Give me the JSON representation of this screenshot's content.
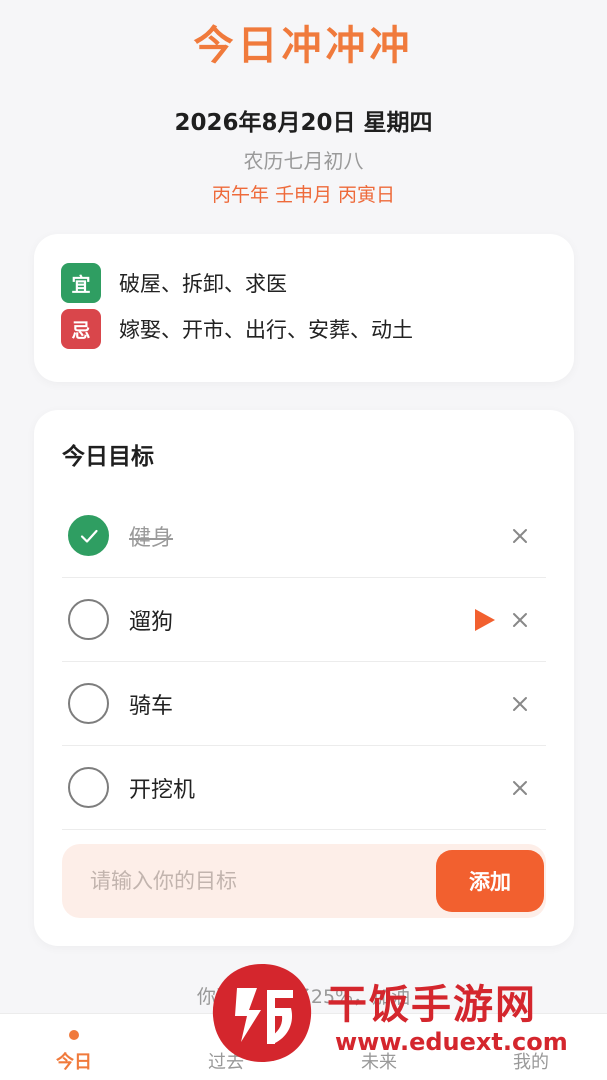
{
  "header": {
    "app_title": "今日冲冲冲",
    "date": "2026年8月20日 星期四",
    "lunar_date": "农历七月初八",
    "ganzhi": "丙午年 壬申月 丙寅日"
  },
  "almanac": {
    "yi_label": "宜",
    "yi_text": "破屋、拆卸、求医",
    "ji_label": "忌",
    "ji_text": "嫁娶、开市、出行、安葬、动土"
  },
  "goals": {
    "title": "今日目标",
    "items": [
      {
        "label": "健身",
        "done": true
      },
      {
        "label": "遛狗",
        "done": false,
        "playing": true
      },
      {
        "label": "骑车",
        "done": false
      },
      {
        "label": "开挖机",
        "done": false
      }
    ],
    "input_placeholder": "请输入你的目标",
    "add_label": "添加"
  },
  "progress": {
    "text": "你已经完成了25%，加油"
  },
  "tabbar": {
    "tabs": [
      "今日",
      "过去",
      "未来",
      "我的"
    ],
    "active_index": 0
  },
  "watermark": {
    "brand": "干饭手游网",
    "url": "www.eduext.com"
  },
  "colors": {
    "accent": "#f07a3c",
    "yi_green": "#2f9e62",
    "ji_red": "#d9464b",
    "add_button": "#f2602f"
  }
}
